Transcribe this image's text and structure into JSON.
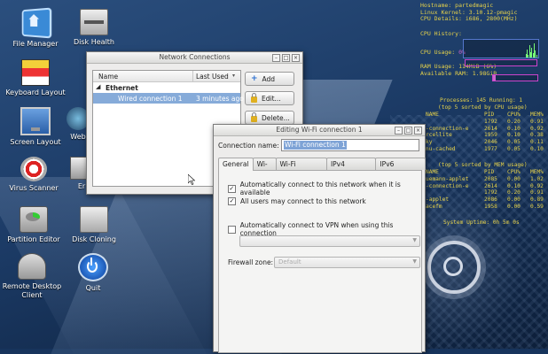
{
  "desktop": {
    "icons": [
      {
        "id": "file-manager",
        "label": "File Manager"
      },
      {
        "id": "disk-health",
        "label": "Disk Health"
      },
      {
        "id": "keyboard-layout",
        "label": "Keyboard Layout"
      },
      {
        "id": "screen-layout",
        "label": "Screen Layout"
      },
      {
        "id": "web",
        "label": "Web"
      },
      {
        "id": "virus-scanner",
        "label": "Virus Scanner"
      },
      {
        "id": "er",
        "label": "Er"
      },
      {
        "id": "partition-editor",
        "label": "Partition Editor"
      },
      {
        "id": "disk-cloning",
        "label": "Disk Cloning"
      },
      {
        "id": "remote-desktop",
        "label": "Remote Desktop Client"
      },
      {
        "id": "quit",
        "label": "Quit"
      }
    ]
  },
  "conky": {
    "hostname_label": "Hostname:",
    "hostname": "partedmagic",
    "kernel_label": "Linux Kernel:",
    "kernel": "3.10.12-pmagic",
    "cpu_details_label": "CPU Details:",
    "cpu_details": "i686, 2800(MHz)",
    "cpu_history_label": "CPU History:",
    "cpu_usage_label": "CPU Usage:",
    "cpu_usage": "0%",
    "cpu_usage_fraction": 0.0,
    "ram_usage_label": "RAM Usage:",
    "ram_usage": "114MiB (6%)",
    "ram_usage_fraction": 0.06,
    "available_ram_label": "Available RAM:",
    "available_ram": "1.98GiB",
    "processes_line": "Processes: 145   Running: 1",
    "top_cpu_title": "(top 5 sorted by CPU usage)",
    "top_mem_title": "(top 5 sorted by MEM usage)",
    "col_name": "NAME",
    "col_pid": "PID",
    "col_cpu": "CPU%",
    "col_mem": "MEM%",
    "top_cpu": [
      {
        "name": "",
        "pid": "1792",
        "cpu": "0.20",
        "mem": "0.91"
      },
      {
        "name": "-connection-e",
        "pid": "2614",
        "cpu": "0.10",
        "mem": "0.92"
      },
      {
        "name": "rcellite",
        "pid": "1959",
        "cpu": "0.10",
        "mem": "0.38"
      },
      {
        "name": "ky",
        "pid": "2046",
        "cpu": "0.05",
        "mem": "0.11"
      },
      {
        "name": "nu-cached",
        "pid": "1977",
        "cpu": "0.05",
        "mem": "0.10"
      }
    ],
    "top_mem": [
      {
        "name": "uemann-applet",
        "pid": "2085",
        "cpu": "0.00",
        "mem": "1.02"
      },
      {
        "name": "-connection-e",
        "pid": "2614",
        "cpu": "0.10",
        "mem": "0.92"
      },
      {
        "name": "",
        "pid": "1792",
        "cpu": "0.20",
        "mem": "0.91"
      },
      {
        "name": "-applet",
        "pid": "2086",
        "cpu": "0.00",
        "mem": "0.89"
      },
      {
        "name": "acefm",
        "pid": "1958",
        "cpu": "0.00",
        "mem": "0.59"
      }
    ],
    "uptime": "System Uptime: 0h 5m 0s"
  },
  "network_connections": {
    "title": "Network Connections",
    "col_name": "Name",
    "col_last_used": "Last Used",
    "group": "Ethernet",
    "connection_name": "Wired connection 1",
    "connection_last_used": "3 minutes ago",
    "add_label": "Add",
    "edit_label": "Edit...",
    "delete_label": "Delete..."
  },
  "editing_dialog": {
    "title": "Editing Wi-Fi connection 1",
    "connection_name_label": "Connection name:",
    "connection_name_value": "Wi-Fi connection 1",
    "tabs": [
      "General",
      "Wi-Fi",
      "Wi-Fi Security",
      "IPv4 Settings",
      "IPv6 Settings"
    ],
    "active_tab": "General",
    "auto_connect_label": "Automatically connect to this network when it is available",
    "auto_connect_checked": true,
    "all_users_label": "All users may connect to this network",
    "all_users_checked": true,
    "auto_vpn_label": "Automatically connect to VPN when using this connection",
    "auto_vpn_checked": false,
    "firewall_zone_label": "Firewall zone:",
    "firewall_zone_value": "Default"
  }
}
